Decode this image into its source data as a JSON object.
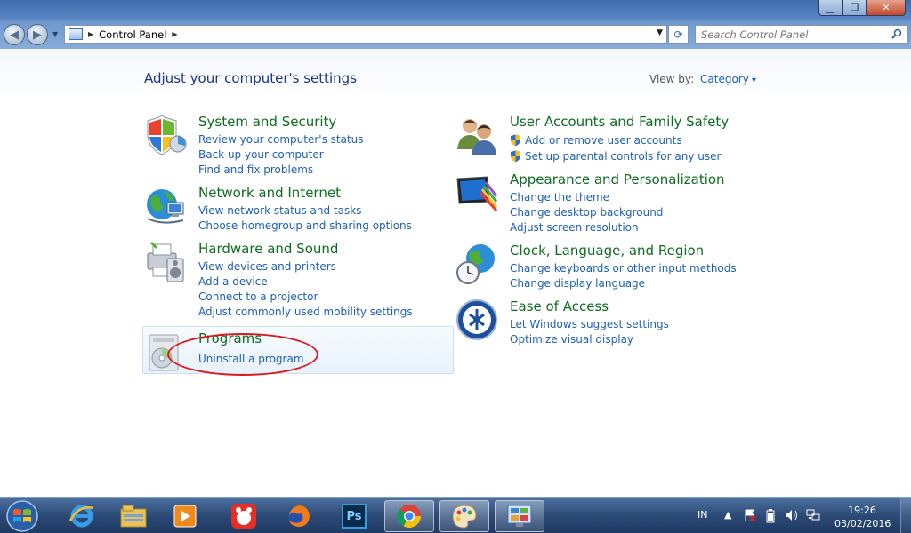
{
  "address_bar": {
    "path": [
      "Control Panel"
    ],
    "search_placeholder": "Search Control Panel"
  },
  "page": {
    "heading": "Adjust your computer's settings",
    "view_by_label": "View by:",
    "view_by_value": "Category"
  },
  "categories": {
    "system_security": {
      "title": "System and Security",
      "links": [
        "Review your computer's status",
        "Back up your computer",
        "Find and fix problems"
      ]
    },
    "network_internet": {
      "title": "Network and Internet",
      "links": [
        "View network status and tasks",
        "Choose homegroup and sharing options"
      ]
    },
    "hardware_sound": {
      "title": "Hardware and Sound",
      "links": [
        "View devices and printers",
        "Add a device",
        "Connect to a projector",
        "Adjust commonly used mobility settings"
      ]
    },
    "programs": {
      "title": "Programs",
      "links": [
        "Uninstall a program"
      ]
    },
    "user_accounts": {
      "title": "User Accounts and Family Safety",
      "links": [
        "Add or remove user accounts",
        "Set up parental controls for any user"
      ]
    },
    "appearance": {
      "title": "Appearance and Personalization",
      "links": [
        "Change the theme",
        "Change desktop background",
        "Adjust screen resolution"
      ]
    },
    "clock_region": {
      "title": "Clock, Language, and Region",
      "links": [
        "Change keyboards or other input methods",
        "Change display language"
      ]
    },
    "ease_access": {
      "title": "Ease of Access",
      "links": [
        "Let Windows suggest settings",
        "Optimize visual display"
      ]
    }
  },
  "taskbar": {
    "pinned": [
      "internet-explorer",
      "file-explorer",
      "media-player",
      "app-red",
      "firefox",
      "photoshop",
      "chrome",
      "paint",
      "control-panel"
    ],
    "photoshop_label": "Ps",
    "language": "IN",
    "time": "19:26",
    "date": "03/02/2016"
  },
  "colors": {
    "link": "#1e5fb5",
    "category_title": "#0d6d1f",
    "heading": "#1e3287",
    "annotation_ring": "#d91b1b"
  }
}
